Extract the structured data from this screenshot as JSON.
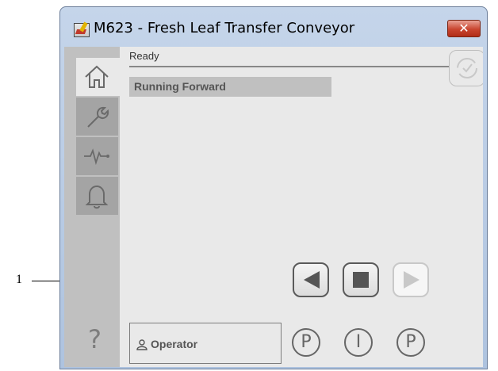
{
  "callout": {
    "number": "1"
  },
  "window": {
    "title": "M623 - Fresh Leaf Transfer Conveyor",
    "close_label": "✕"
  },
  "sidebar": {
    "items": [
      {
        "icon": "home-icon",
        "active": true
      },
      {
        "icon": "wrench-icon",
        "active": false
      },
      {
        "icon": "pulse-icon",
        "active": false
      },
      {
        "icon": "bell-icon",
        "active": false
      }
    ],
    "help_label": "?"
  },
  "status": {
    "text": "Ready"
  },
  "state": {
    "text": "Running Forward"
  },
  "controls": {
    "reverse": {
      "icon": "play-reverse-icon",
      "enabled": true
    },
    "stop": {
      "icon": "stop-icon",
      "enabled": true
    },
    "forward": {
      "icon": "play-forward-icon",
      "enabled": false
    }
  },
  "operator": {
    "label": "Operator"
  },
  "modes": [
    {
      "letter": "P"
    },
    {
      "letter": "I"
    },
    {
      "letter": "P"
    }
  ],
  "colors": {
    "title_bar": "#aec3df",
    "close_button": "#c9452f",
    "panel_bg": "#e9e9e9",
    "sidebar_bg": "#c0c0c0",
    "state_bg": "#c0c0c0"
  }
}
